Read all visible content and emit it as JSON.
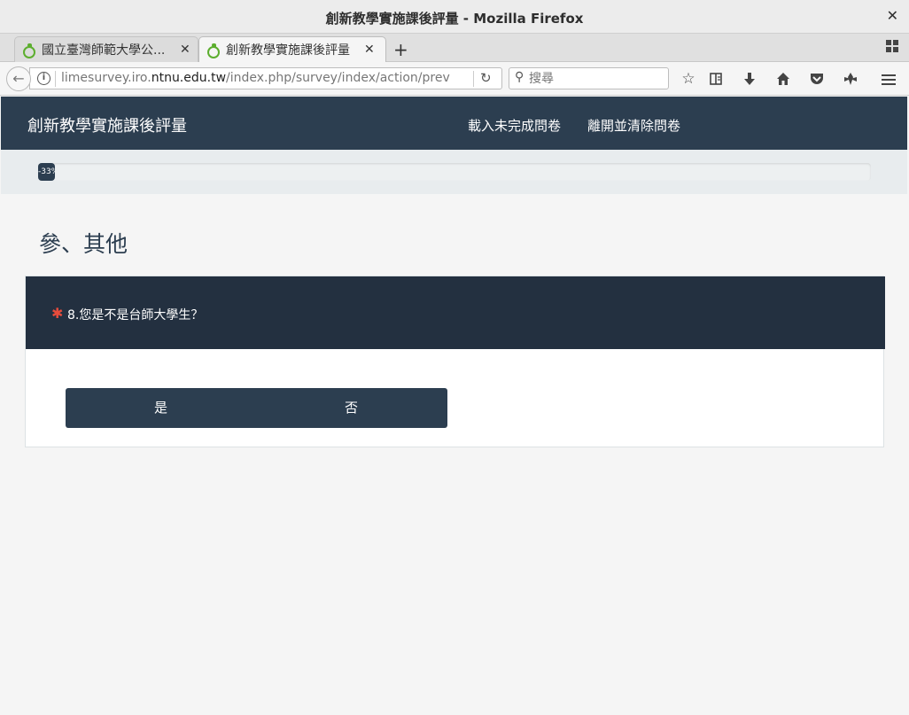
{
  "window": {
    "title": "創新教學實施課後評量 - Mozilla Firefox",
    "close_glyph": "✕"
  },
  "tabs": [
    {
      "label": "國立臺灣師範大學公...",
      "close": "✕"
    },
    {
      "label": "創新教學實施課後評量",
      "close": "✕"
    }
  ],
  "toolbar": {
    "back_glyph": "←",
    "url_host_prefix": "limesurvey.iro.",
    "url_host_domain": "ntnu.edu.tw",
    "url_path": "/index.php/survey/index/action/previewque",
    "reload_glyph": "↻",
    "search_placeholder": "搜尋",
    "new_tab_glyph": "+"
  },
  "survey": {
    "title": "創新教學實施課後評量",
    "nav": {
      "load": "載入未完成問卷",
      "exit": "離開並清除問卷"
    },
    "progress_label": "-33%",
    "progress_fraction": 0.02,
    "group_title": "參、其他",
    "question": {
      "required_marker": "✱",
      "text": "8.您是不是台師大學生？",
      "options": [
        "是",
        "否"
      ]
    }
  },
  "colors": {
    "header": "#2c3e50",
    "question_head": "#233040",
    "required": "#e74c3c",
    "favicon": "#5cae2e"
  }
}
